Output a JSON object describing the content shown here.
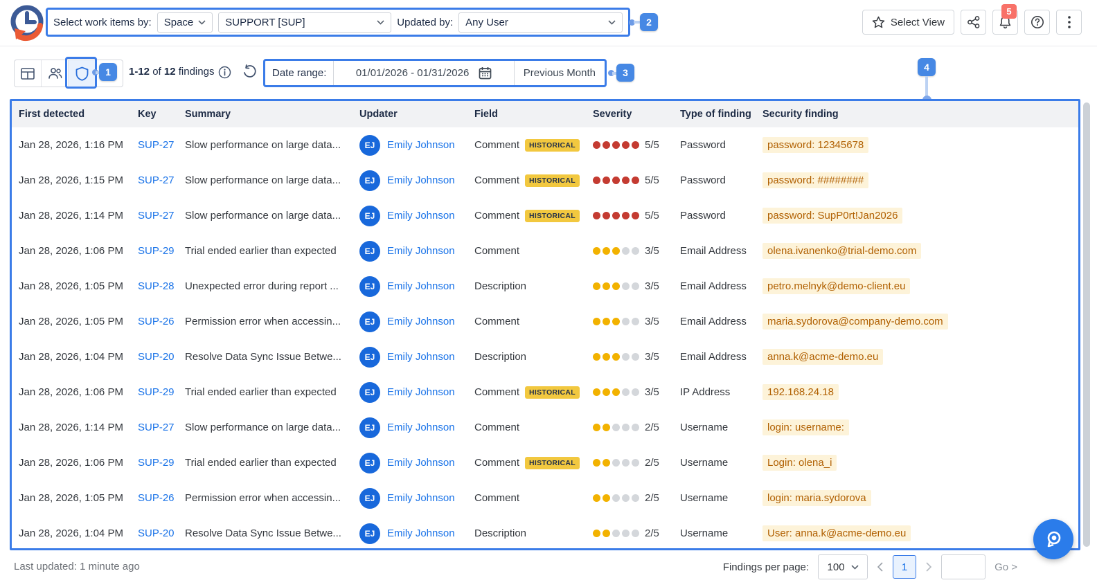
{
  "header": {
    "filter_bar": {
      "label": "Select work items by:",
      "scope_value": "Space",
      "project_value": "SUPPORT [SUP]",
      "updated_by_label": "Updated by:",
      "user_value": "Any User"
    },
    "actions": {
      "select_view_label": "Select View",
      "notification_count": "5"
    }
  },
  "callouts": {
    "step1": "1",
    "step2": "2",
    "step3": "3",
    "step4": "4"
  },
  "toolbar": {
    "findings_count": {
      "range": "1-12",
      "of": "of",
      "total": "12",
      "suffix": "findings"
    },
    "date_range": {
      "label": "Date range:",
      "value": "01/01/2026 - 01/31/2026",
      "preset": "Previous Month"
    }
  },
  "table": {
    "columns": {
      "detected": "First detected",
      "key": "Key",
      "summary": "Summary",
      "updater": "Updater",
      "field": "Field",
      "severity": "Severity",
      "type": "Type of finding",
      "finding": "Security finding"
    },
    "historical_label": "HISTORICAL",
    "rows": [
      {
        "detected": "Jan 28, 2026, 1:16 PM",
        "key": "SUP-27",
        "summary": "Slow performance on large data...",
        "initials": "EJ",
        "updater": "Emily Johnson",
        "field": "Comment",
        "historical": true,
        "severity": 5,
        "severity_label": "5/5",
        "type": "Password",
        "finding": "password: 12345678"
      },
      {
        "detected": "Jan 28, 2026, 1:15 PM",
        "key": "SUP-27",
        "summary": "Slow performance on large data...",
        "initials": "EJ",
        "updater": "Emily Johnson",
        "field": "Comment",
        "historical": true,
        "severity": 5,
        "severity_label": "5/5",
        "type": "Password",
        "finding": "password: ########"
      },
      {
        "detected": "Jan 28, 2026, 1:14 PM",
        "key": "SUP-27",
        "summary": "Slow performance on large data...",
        "initials": "EJ",
        "updater": "Emily Johnson",
        "field": "Comment",
        "historical": true,
        "severity": 5,
        "severity_label": "5/5",
        "type": "Password",
        "finding": "password: SupP0rt!Jan2026"
      },
      {
        "detected": "Jan 28, 2026, 1:06 PM",
        "key": "SUP-29",
        "summary": "Trial ended earlier than expected",
        "initials": "EJ",
        "updater": "Emily Johnson",
        "field": "Comment",
        "historical": false,
        "severity": 3,
        "severity_label": "3/5",
        "type": "Email Address",
        "finding": "olena.ivanenko@trial-demo.com"
      },
      {
        "detected": "Jan 28, 2026, 1:05 PM",
        "key": "SUP-28",
        "summary": "Unexpected error during report ...",
        "initials": "EJ",
        "updater": "Emily Johnson",
        "field": "Description",
        "historical": false,
        "severity": 3,
        "severity_label": "3/5",
        "type": "Email Address",
        "finding": "petro.melnyk@demo-client.eu"
      },
      {
        "detected": "Jan 28, 2026, 1:05 PM",
        "key": "SUP-26",
        "summary": "Permission error when accessin...",
        "initials": "EJ",
        "updater": "Emily Johnson",
        "field": "Comment",
        "historical": false,
        "severity": 3,
        "severity_label": "3/5",
        "type": "Email Address",
        "finding": "maria.sydorova@company-demo.com"
      },
      {
        "detected": "Jan 28, 2026, 1:04 PM",
        "key": "SUP-20",
        "summary": "Resolve Data Sync Issue Betwe...",
        "initials": "EJ",
        "updater": "Emily Johnson",
        "field": "Description",
        "historical": false,
        "severity": 3,
        "severity_label": "3/5",
        "type": "Email Address",
        "finding": "anna.k@acme-demo.eu"
      },
      {
        "detected": "Jan 28, 2026, 1:06 PM",
        "key": "SUP-29",
        "summary": "Trial ended earlier than expected",
        "initials": "EJ",
        "updater": "Emily Johnson",
        "field": "Comment",
        "historical": true,
        "severity": 3,
        "severity_label": "3/5",
        "type": "IP Address",
        "finding": "192.168.24.18"
      },
      {
        "detected": "Jan 28, 2026, 1:14 PM",
        "key": "SUP-27",
        "summary": "Slow performance on large data...",
        "initials": "EJ",
        "updater": "Emily Johnson",
        "field": "Comment",
        "historical": false,
        "severity": 2,
        "severity_label": "2/5",
        "type": "Username",
        "finding": "login: username:"
      },
      {
        "detected": "Jan 28, 2026, 1:06 PM",
        "key": "SUP-29",
        "summary": "Trial ended earlier than expected",
        "initials": "EJ",
        "updater": "Emily Johnson",
        "field": "Comment",
        "historical": true,
        "severity": 2,
        "severity_label": "2/5",
        "type": "Username",
        "finding": "Login: olena_i"
      },
      {
        "detected": "Jan 28, 2026, 1:05 PM",
        "key": "SUP-26",
        "summary": "Permission error when accessin...",
        "initials": "EJ",
        "updater": "Emily Johnson",
        "field": "Comment",
        "historical": false,
        "severity": 2,
        "severity_label": "2/5",
        "type": "Username",
        "finding": "login: maria.sydorova"
      },
      {
        "detected": "Jan 28, 2026, 1:04 PM",
        "key": "SUP-20",
        "summary": "Resolve Data Sync Issue Betwe...",
        "initials": "EJ",
        "updater": "Emily Johnson",
        "field": "Description",
        "historical": false,
        "severity": 2,
        "severity_label": "2/5",
        "type": "Username",
        "finding": "User: anna.k@acme-demo.eu"
      }
    ]
  },
  "footer": {
    "last_updated": "Last updated: 1 minute ago",
    "per_page_label": "Findings per page:",
    "per_page_value": "100",
    "current_page": "1",
    "go_label": "Go >"
  },
  "icons": {
    "app-logo": "clock-with-orange-history-arrow",
    "table-view-icon": "grid-table",
    "people-view-icon": "two-users",
    "security-view-icon": "shield-outline",
    "timeline-view-icon": "branch-timeline",
    "info-icon": "circled-i",
    "refresh-icon": "counterclockwise-arrow",
    "calendar-icon": "calendar-grid",
    "star-icon": "star-outline",
    "share-icon": "share-nodes",
    "bell-icon": "notification-bell",
    "help-icon": "circled-question-mark",
    "kebab-icon": "vertical-three-dots",
    "chevron-down-icon": "v-chevron",
    "chevron-left-icon": "left-angle",
    "chevron-right-icon": "right-angle",
    "search-fab-icon": "magnifier-with-dot"
  },
  "colors": {
    "callout_blue": "#3b7ce8",
    "badge_blue": "#4688e4",
    "link_blue": "#1a73e8",
    "avatar_blue": "#1868db",
    "severity_red": "#c43b31",
    "severity_yellow": "#f2b200",
    "severity_empty": "#d4d7db",
    "historical_bg": "#f2c83f",
    "finding_text": "#b05f00",
    "finding_bg": "#fdf3d9",
    "notification_red": "#f87168",
    "header_bg": "#f1f2f4"
  }
}
